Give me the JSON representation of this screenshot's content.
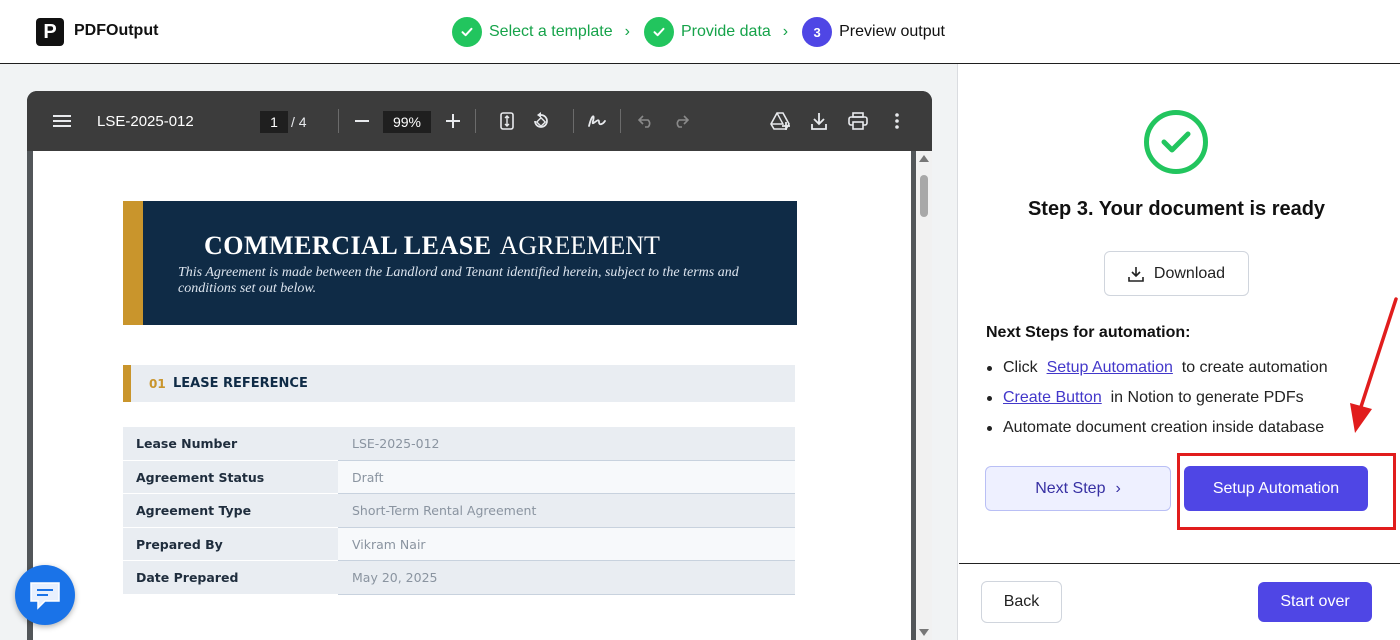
{
  "app": {
    "logo_letter": "P",
    "brand": "PDFOutput"
  },
  "stepper": {
    "steps": [
      {
        "label": "Select a template",
        "state": "done",
        "number": ""
      },
      {
        "label": "Provide data",
        "state": "done",
        "number": ""
      },
      {
        "label": "Preview output",
        "state": "current",
        "number": "3"
      }
    ]
  },
  "viewer": {
    "doc_name": "LSE-2025-012",
    "page_current": "1",
    "page_total": "/  4",
    "zoom": "99%"
  },
  "document": {
    "banner_title_bold": "COMMERCIAL LEASE",
    "banner_title_rest": "AGREEMENT",
    "banner_subtitle": "This Agreement is made between the Landlord and Tenant identified herein, subject to the terms and conditions set out below.",
    "section_number": "01",
    "section_title": "LEASE REFERENCE",
    "rows": [
      {
        "label": "Lease Number",
        "value": "LSE-2025-012"
      },
      {
        "label": "Agreement Status",
        "value": "Draft"
      },
      {
        "label": "Agreement Type",
        "value": "Short-Term Rental Agreement"
      },
      {
        "label": "Prepared By",
        "value": "Vikram Nair"
      },
      {
        "label": "Date Prepared",
        "value": "May 20, 2025"
      }
    ]
  },
  "panel": {
    "ready_title": "Step 3. Your document is ready",
    "download_label": "Download",
    "next_steps_title": "Next Steps for automation:",
    "bullet1_pre": "Click",
    "bullet1_link": "Setup Automation",
    "bullet1_post": "to create automation",
    "bullet2_link": "Create Button",
    "bullet2_post": "in Notion to generate PDFs",
    "bullet3": "Automate document creation inside database",
    "next_step_label": "Next Step",
    "setup_label": "Setup Automation",
    "back_label": "Back",
    "start_over_label": "Start over"
  },
  "colors": {
    "accent": "#4f46e5",
    "success": "#22c55e",
    "navy": "#0f2b46",
    "gold": "#c9952c",
    "annotation_red": "#e11d1d"
  }
}
